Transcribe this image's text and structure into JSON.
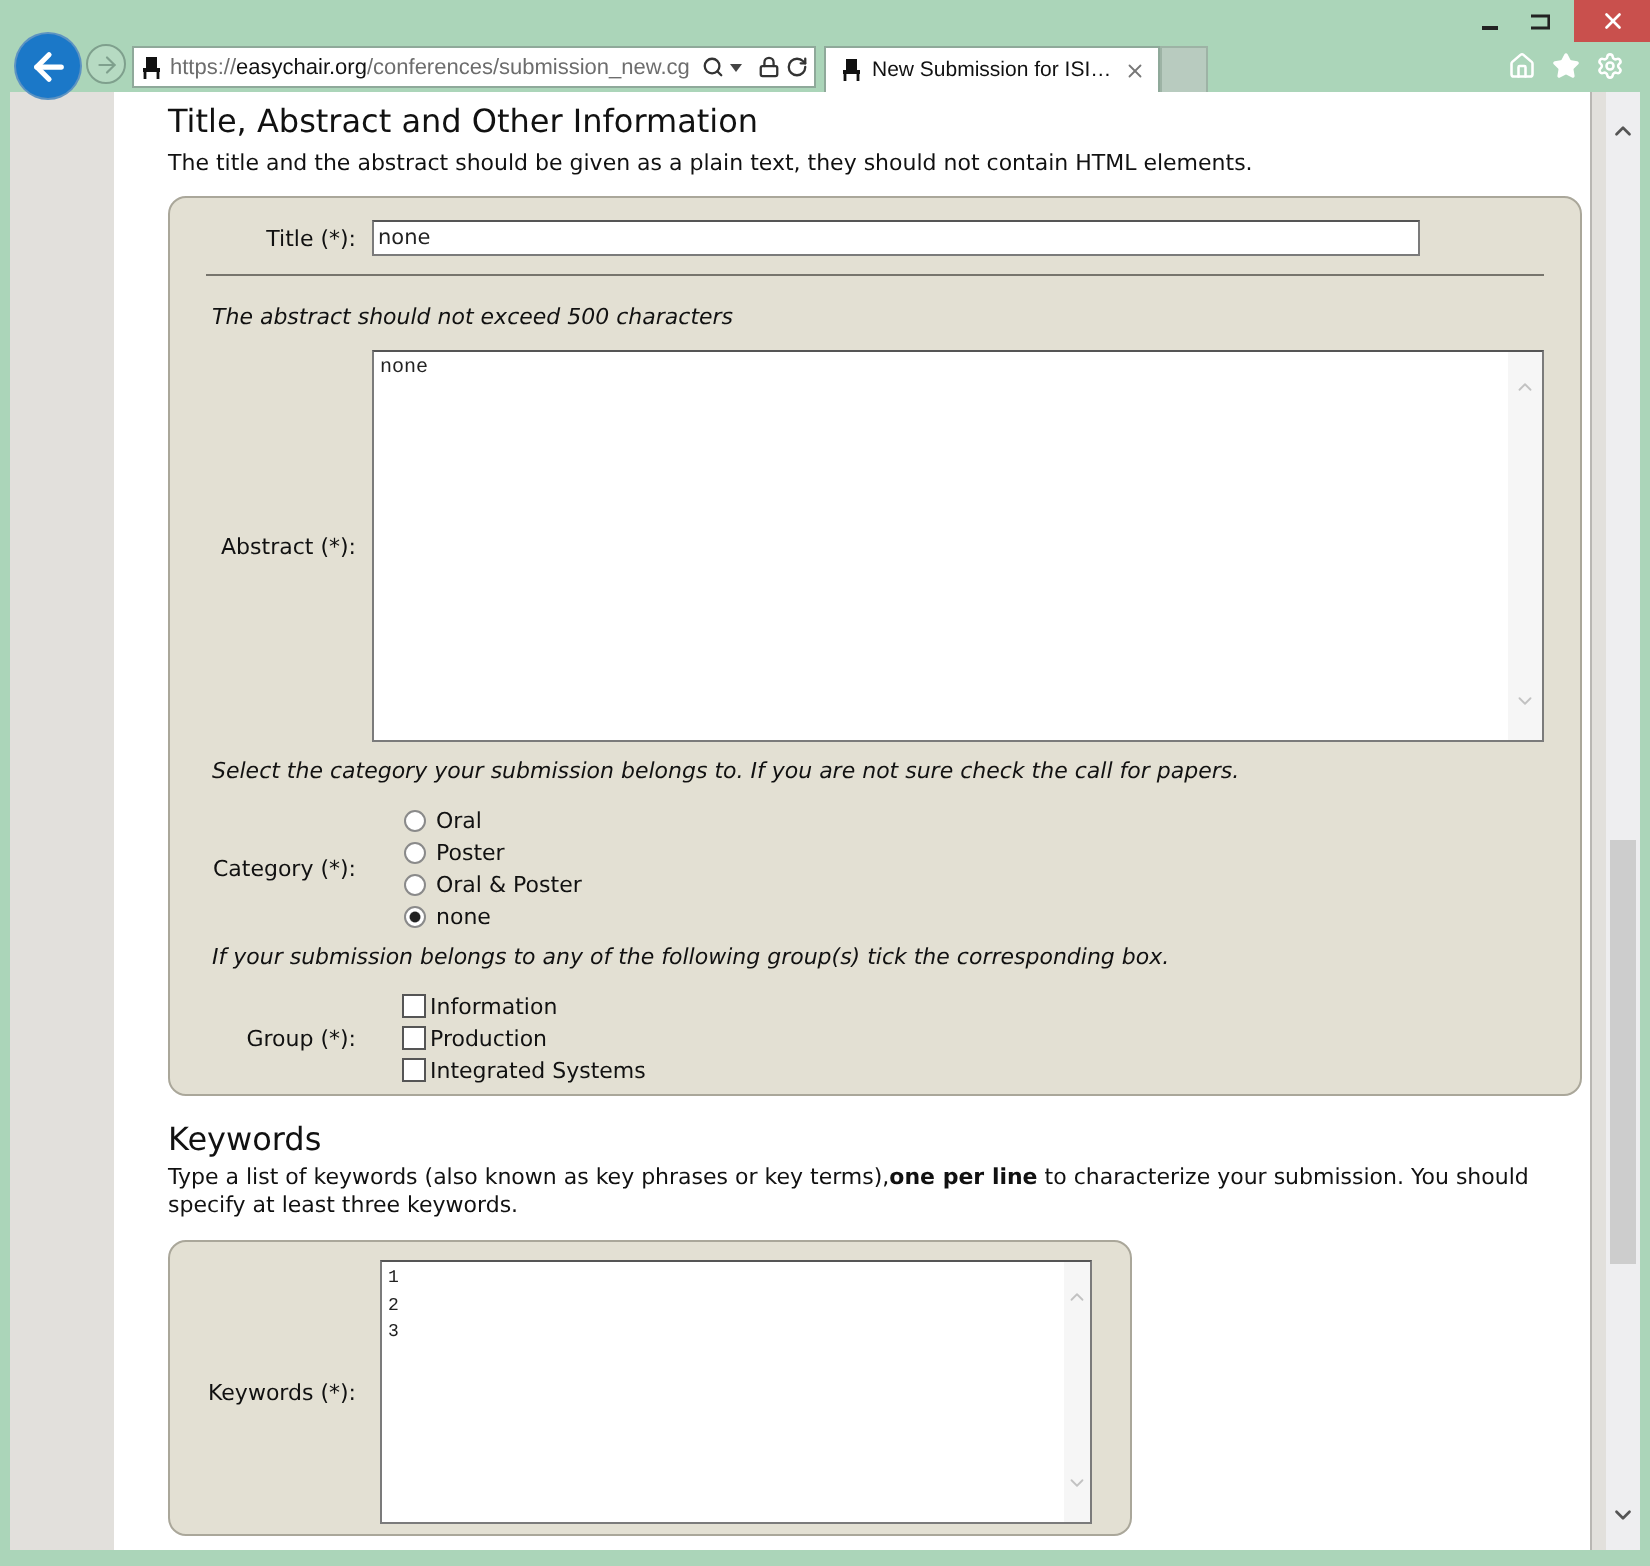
{
  "browser": {
    "address_bar": {
      "scheme": "https://",
      "host": "easychair.org",
      "path": "/conferences/submission_new.cg"
    },
    "tabs": [
      {
        "title": "New Submission for ISI…",
        "selected": true
      }
    ]
  },
  "title_section": {
    "heading": "Title, Abstract and Other Information",
    "intro": "The title and the abstract should be given as a plain text, they should not contain HTML elements.",
    "panel": {
      "title": {
        "label": "Title (*):",
        "value": "none"
      },
      "abstract_note": "The abstract should not exceed 500 characters",
      "abstract": {
        "label": "Abstract (*):",
        "value": "none"
      },
      "category_note": "Select the category your submission belongs to. If you are not sure check the call for papers.",
      "category": {
        "label": "Category (*):",
        "options": [
          {
            "label": "Oral",
            "selected": false
          },
          {
            "label": "Poster",
            "selected": false
          },
          {
            "label": "Oral & Poster",
            "selected": false
          },
          {
            "label": "none",
            "selected": true
          }
        ]
      },
      "group_note": "If your submission belongs to any of the following group(s) tick the corresponding box.",
      "group": {
        "label": "Group (*):",
        "options": [
          {
            "label": "Information",
            "checked": false
          },
          {
            "label": "Production",
            "checked": false
          },
          {
            "label": "Integrated Systems",
            "checked": false
          }
        ]
      }
    }
  },
  "keywords_section": {
    "heading": "Keywords",
    "intro": "Type a list of keywords (also known as key phrases or key terms),**one per line** to characterize your submission. You should specify at least three keywords.",
    "panel": {
      "keywords": {
        "label": "Keywords (*):",
        "value": "1\n2\n3"
      }
    }
  }
}
